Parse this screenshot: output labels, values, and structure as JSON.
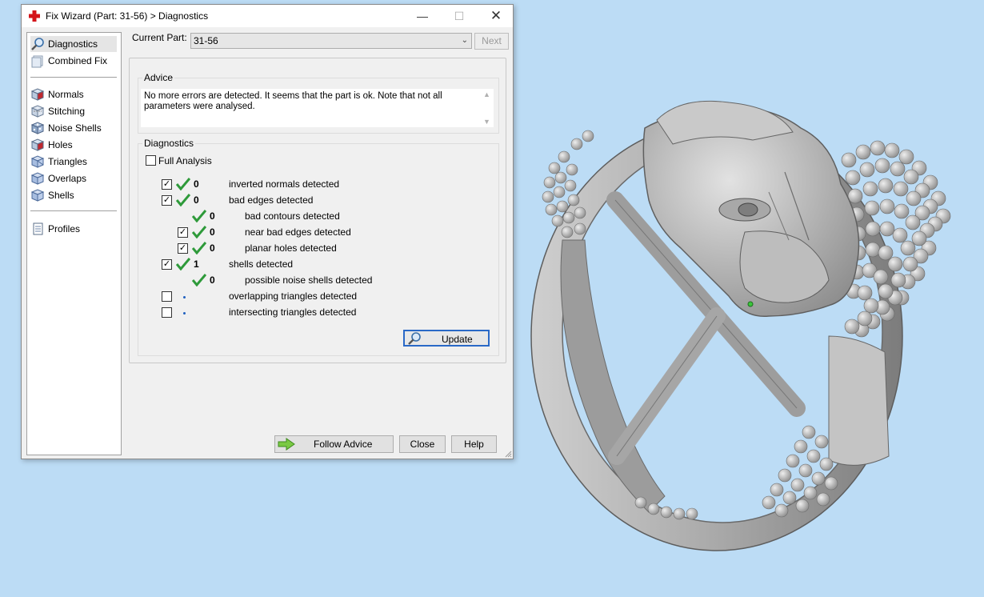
{
  "window": {
    "title": "Fix Wizard (Part: 31-56) > Diagnostics",
    "controls": {
      "minimize": "—",
      "maximize": "☐",
      "close": "✕"
    }
  },
  "nav": {
    "items": [
      {
        "label": "Diagnostics",
        "icon": "magnifier-icon",
        "selected": true
      },
      {
        "label": "Combined Fix",
        "icon": "combined-fix-icon"
      },
      {
        "label": "Normals",
        "icon": "normals-cube-icon"
      },
      {
        "label": "Stitching",
        "icon": "stitching-icon"
      },
      {
        "label": "Noise Shells",
        "icon": "noise-shells-icon"
      },
      {
        "label": "Holes",
        "icon": "holes-cube-icon"
      },
      {
        "label": "Triangles",
        "icon": "triangles-cube-icon"
      },
      {
        "label": "Overlaps",
        "icon": "overlaps-cube-icon"
      },
      {
        "label": "Shells",
        "icon": "shells-cube-icon"
      },
      {
        "label": "Profiles",
        "icon": "profiles-document-icon"
      }
    ]
  },
  "current_part": {
    "label": "Current Part:",
    "value": "31-56",
    "next": "Next"
  },
  "advice": {
    "title": "Advice",
    "text": "No more errors are detected. It seems that the part is ok. Note that not all parameters were analysed."
  },
  "diagnostics": {
    "title": "Diagnostics",
    "full_analysis": {
      "label": "Full Analysis",
      "checked": false
    },
    "rows": [
      {
        "checked": true,
        "status": "ok",
        "count": "0",
        "label": "inverted normals detected"
      },
      {
        "checked": true,
        "status": "ok",
        "count": "0",
        "label": "bad edges detected"
      },
      {
        "checked": null,
        "status": "ok",
        "count": "0",
        "label": "bad contours detected"
      },
      {
        "checked": true,
        "status": "ok",
        "count": "0",
        "label": "near bad edges detected"
      },
      {
        "checked": true,
        "status": "ok",
        "count": "0",
        "label": "planar holes detected"
      },
      {
        "checked": true,
        "status": "ok",
        "count": "1",
        "label": "shells detected"
      },
      {
        "checked": null,
        "status": "ok",
        "count": "0",
        "label": "possible noise shells detected"
      },
      {
        "checked": false,
        "status": "not-analysed",
        "count": "",
        "label": "overlapping triangles detected"
      },
      {
        "checked": false,
        "status": "not-analysed",
        "count": "",
        "label": "intersecting triangles detected"
      }
    ],
    "update": "Update"
  },
  "buttons": {
    "follow_advice": "Follow Advice",
    "close": "Close",
    "help": "Help"
  },
  "colors": {
    "viewport_bg": "#bcdcf5",
    "ok_tick": "#2e9a3a",
    "focus_border": "#2a69c7"
  }
}
